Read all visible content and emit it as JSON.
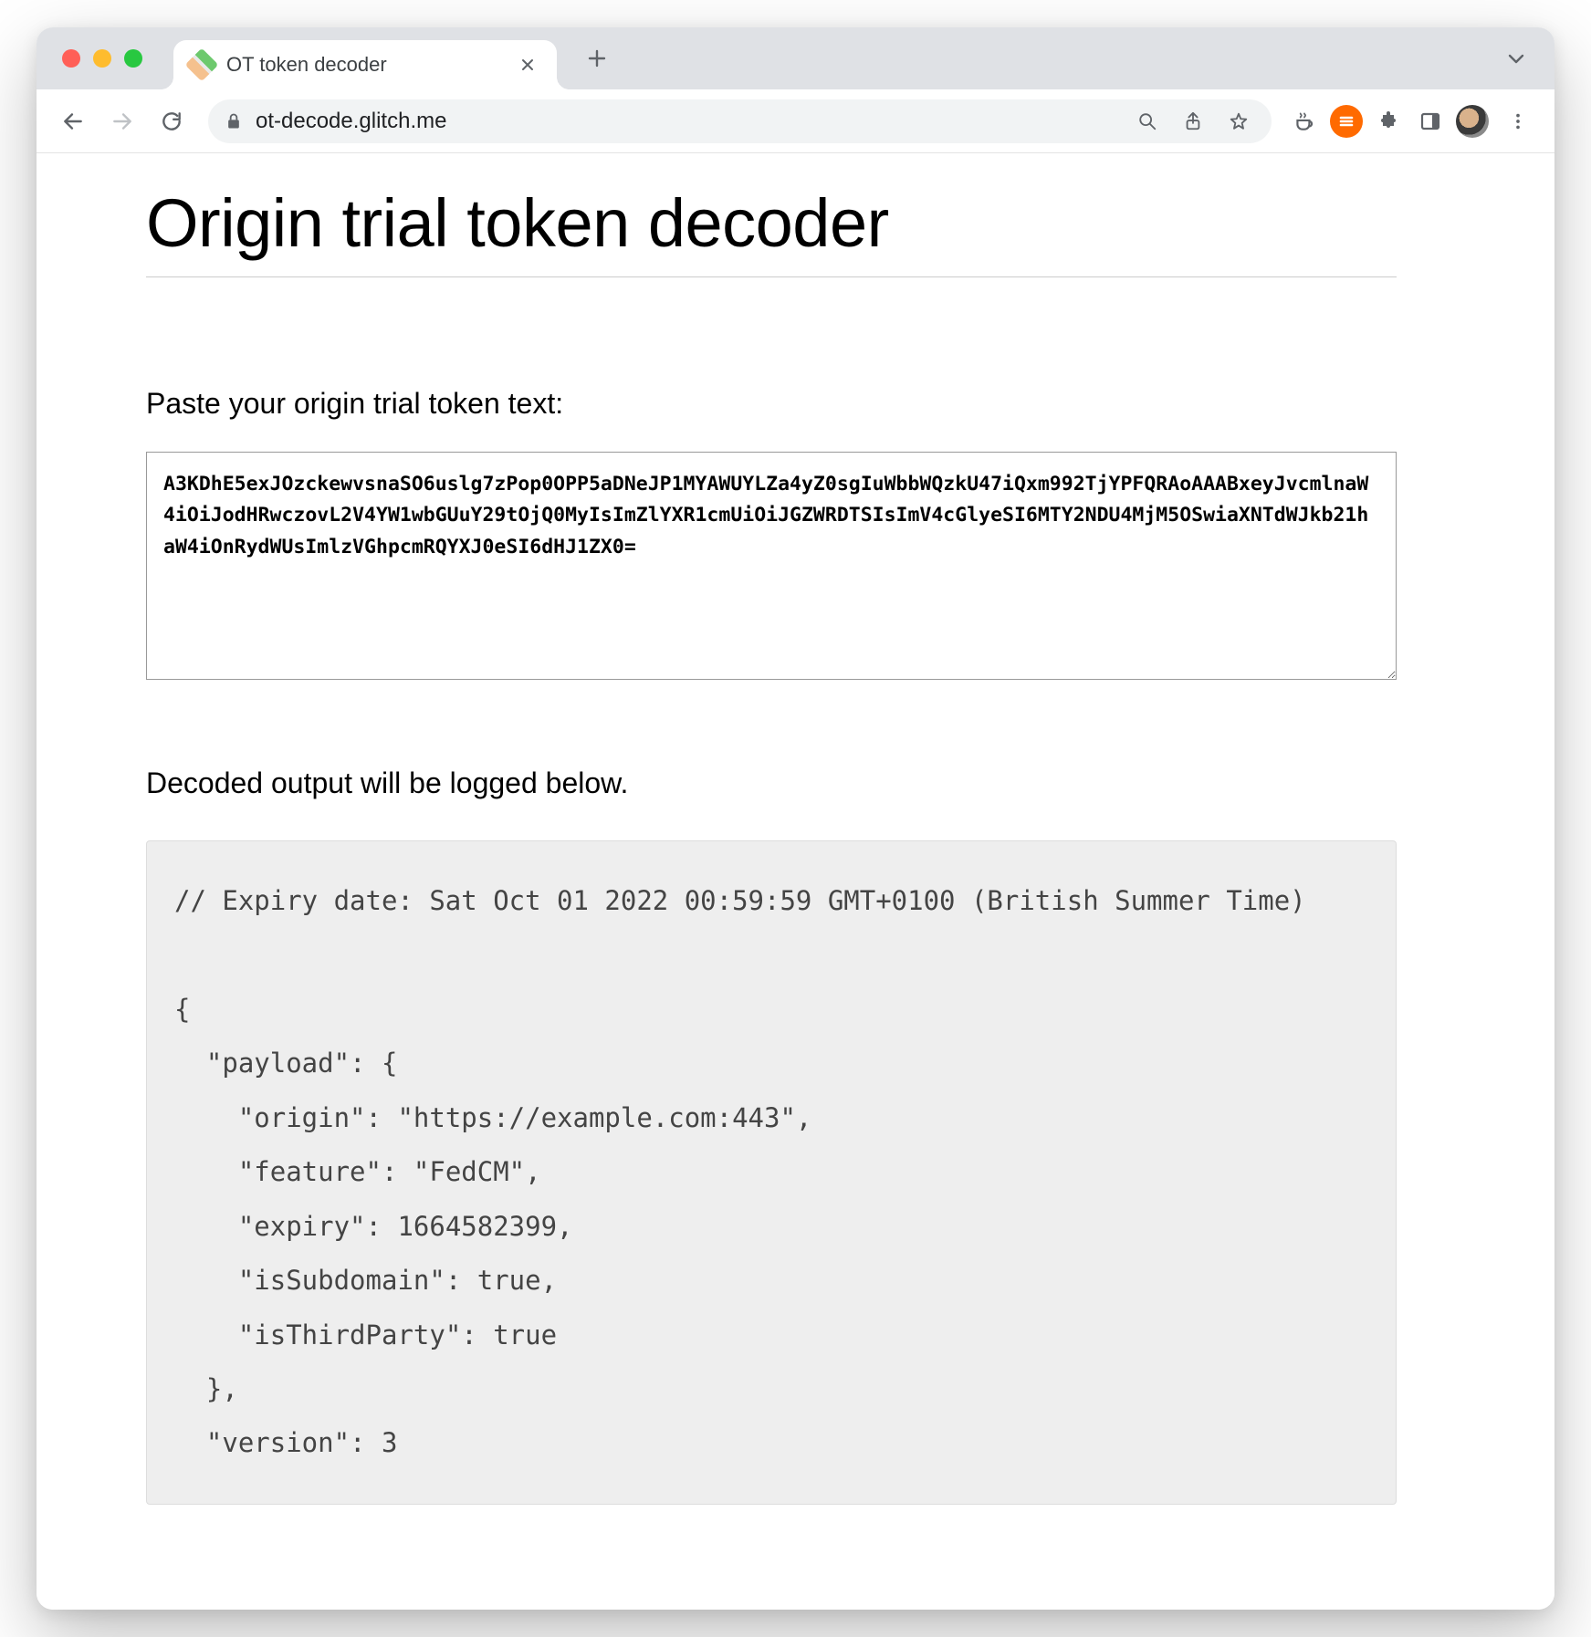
{
  "browser": {
    "tab_title": "OT token decoder",
    "url": "ot-decode.glitch.me"
  },
  "page": {
    "title": "Origin trial token decoder",
    "input_label": "Paste your origin trial token text:",
    "token_value": "A3KDhE5exJOzckewvsnaSO6uslg7zPop0OPP5aDNeJP1MYAWUYLZa4yZ0sgIuWbbWQzkU47iQxm992TjYPFQRAoAAABxeyJvcmlnaW4iOiJodHRwczovL2V4YW1wbGUuY29tOjQ0MyIsImZlYXR1cmUiOiJGZWRDTSIsImV4cGlyeSI6MTY2NDU4MjM5OSwiaXNTdWJkb21haW4iOnRydWUsImlzVGhpcmRQYXJ0eSI6dHJ1ZX0=",
    "output_label": "Decoded output will be logged below.",
    "output_text": "// Expiry date: Sat Oct 01 2022 00:59:59 GMT+0100 (British Summer Time)\n\n{\n  \"payload\": {\n    \"origin\": \"https://example.com:443\",\n    \"feature\": \"FedCM\",\n    \"expiry\": 1664582399,\n    \"isSubdomain\": true,\n    \"isThirdParty\": true\n  },\n  \"version\": 3"
  },
  "decoded": {
    "expiry_date_string": "Sat Oct 01 2022 00:59:59 GMT+0100 (British Summer Time)",
    "payload": {
      "origin": "https://example.com:443",
      "feature": "FedCM",
      "expiry": 1664582399,
      "isSubdomain": true,
      "isThirdParty": true
    },
    "version": 3
  }
}
